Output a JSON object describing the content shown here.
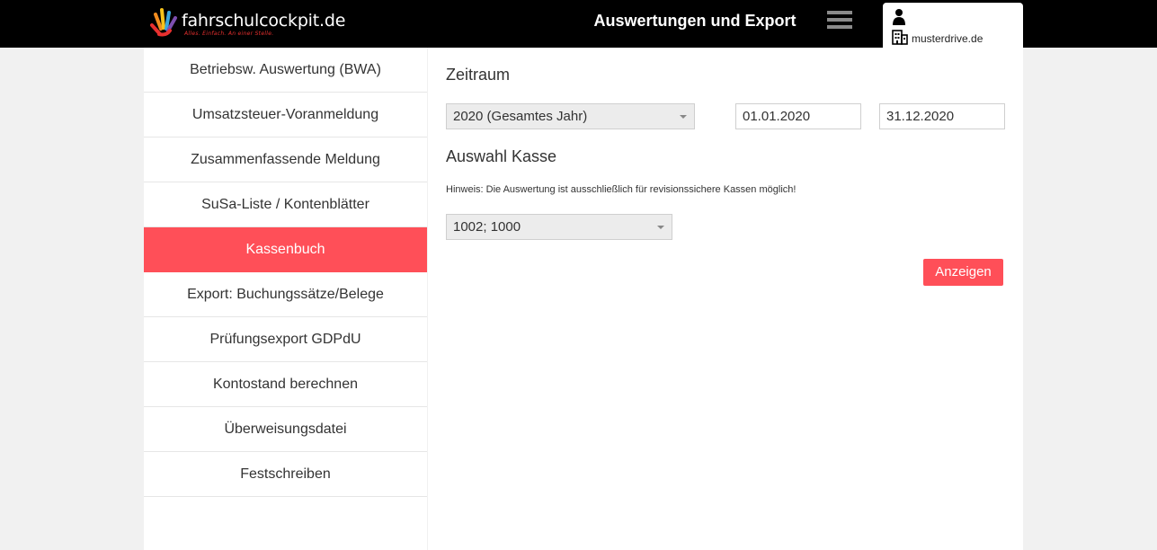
{
  "header": {
    "logo_text": "fahrschulcockpit.de",
    "logo_slogan": "Alles. Einfach. An einer Stelle.",
    "title": "Auswertungen und Export",
    "user_domain": "musterdrive.de"
  },
  "sidebar": {
    "items": [
      {
        "label": "Betriebsw. Auswertung (BWA)",
        "active": false
      },
      {
        "label": "Umsatzsteuer-Voranmeldung",
        "active": false
      },
      {
        "label": "Zusammenfassende Meldung",
        "active": false
      },
      {
        "label": "SuSa-Liste / Kontenblätter",
        "active": false
      },
      {
        "label": "Kassenbuch",
        "active": true
      },
      {
        "label": "Export: Buchungssätze/Belege",
        "active": false
      },
      {
        "label": "Prüfungsexport GDPdU",
        "active": false
      },
      {
        "label": "Kontostand berechnen",
        "active": false
      },
      {
        "label": "Überweisungsdatei",
        "active": false
      },
      {
        "label": "Festschreiben",
        "active": false
      }
    ]
  },
  "main": {
    "period_title": "Zeitraum",
    "period_select": "2020 (Gesamtes Jahr)",
    "date_from": "01.01.2020",
    "date_to": "31.12.2020",
    "cash_title": "Auswahl Kasse",
    "hint": "Hinweis: Die Auswertung ist ausschließlich für revisionssichere Kassen möglich!",
    "cash_select": "1002; 1000",
    "show_button": "Anzeigen"
  },
  "colors": {
    "accent": "#ff4f58",
    "topbar": "#000000",
    "background": "#f1f1f1"
  }
}
